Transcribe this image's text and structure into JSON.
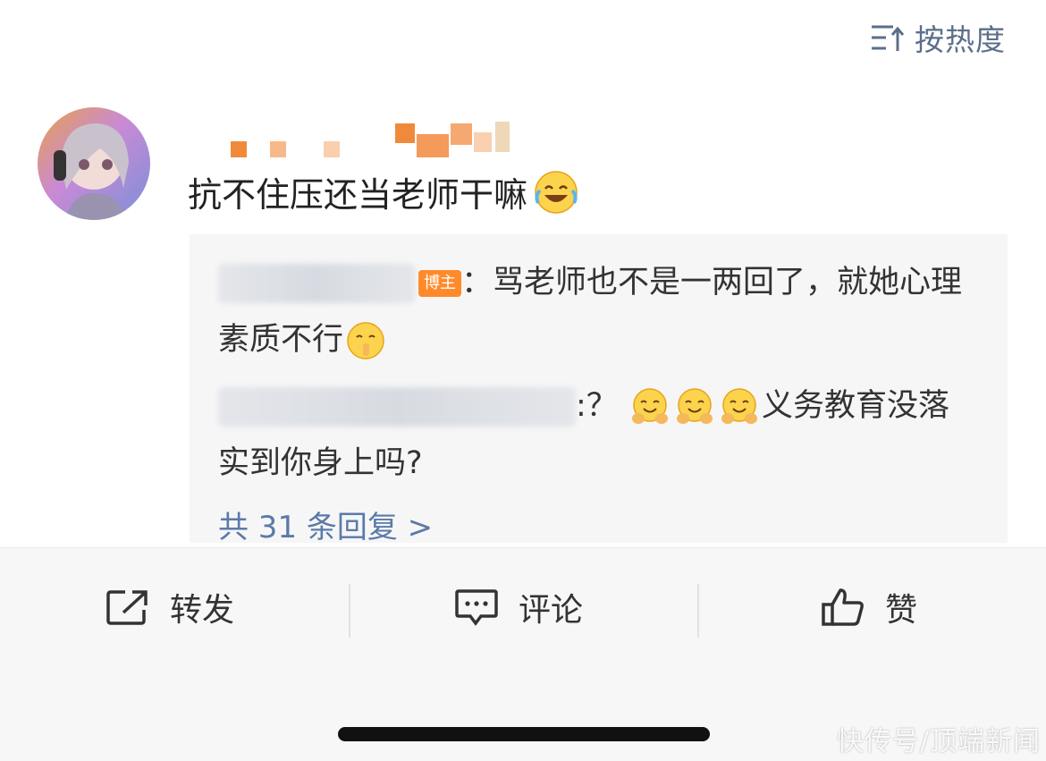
{
  "sort": {
    "label": "按热度",
    "icon": "sort-icon"
  },
  "comment": {
    "text": "抗不住压还当老师干嘛",
    "emoji": "laugh-cry-emoji"
  },
  "replies": [
    {
      "badge": "博主",
      "text": "：骂老师也不是一两回了，就她心理素质不行",
      "emoji": "shush-emoji"
    },
    {
      "text_before": ":？",
      "text_after": "义务教育没落实到你身上吗?",
      "emoji": "hug-emoji"
    }
  ],
  "more_replies": "共 31 条回复 >",
  "actions": {
    "repost": "转发",
    "comment": "评论",
    "like": "赞"
  },
  "colors": {
    "link": "#5b7aa8",
    "badge": "#ff8a2b",
    "reply_bg": "#f6f6f7"
  },
  "watermark": "快传号/顶端新闻"
}
